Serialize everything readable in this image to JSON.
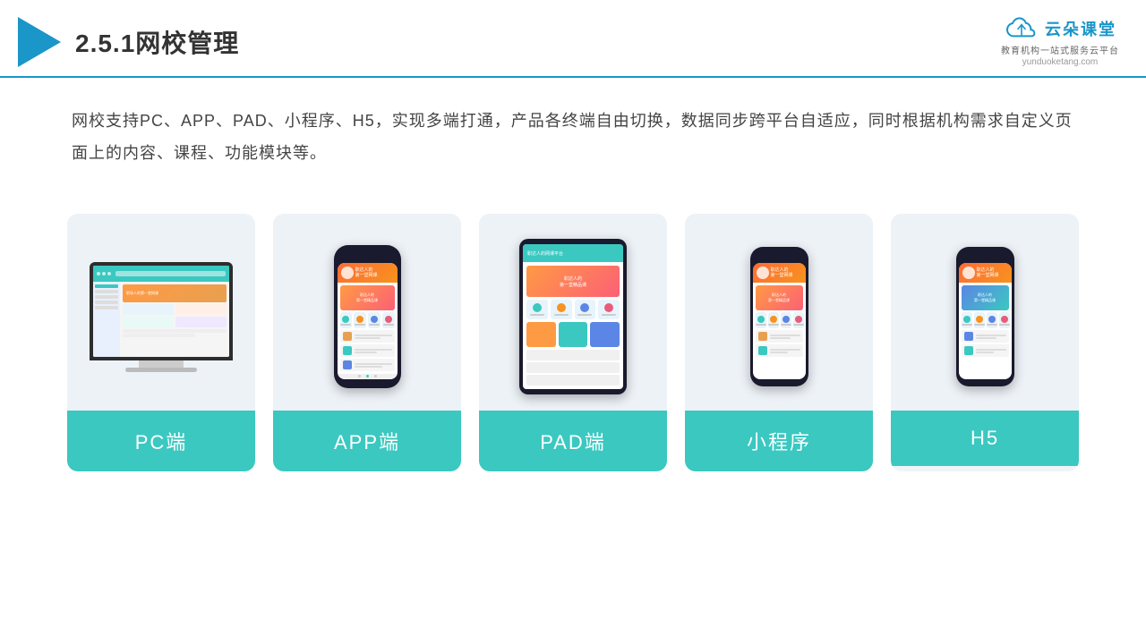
{
  "header": {
    "title": "2.5.1网校管理",
    "brand_name": "云朵课堂",
    "brand_url": "yunduoketang.com",
    "brand_tagline": "教育机构一站\n式服务云平台"
  },
  "description": "网校支持PC、APP、PAD、小程序、H5，实现多端打通，产品各终端自由切换，数据同步跨平台自适应，同时根据机构需求自定义页面上的内容、课程、功能模块等。",
  "cards": [
    {
      "id": "pc",
      "label": "PC端"
    },
    {
      "id": "app",
      "label": "APP端"
    },
    {
      "id": "pad",
      "label": "PAD端"
    },
    {
      "id": "miniapp",
      "label": "小程序"
    },
    {
      "id": "h5",
      "label": "H5"
    }
  ],
  "accent_color": "#3bc8c0",
  "border_color": "#1a96c8"
}
